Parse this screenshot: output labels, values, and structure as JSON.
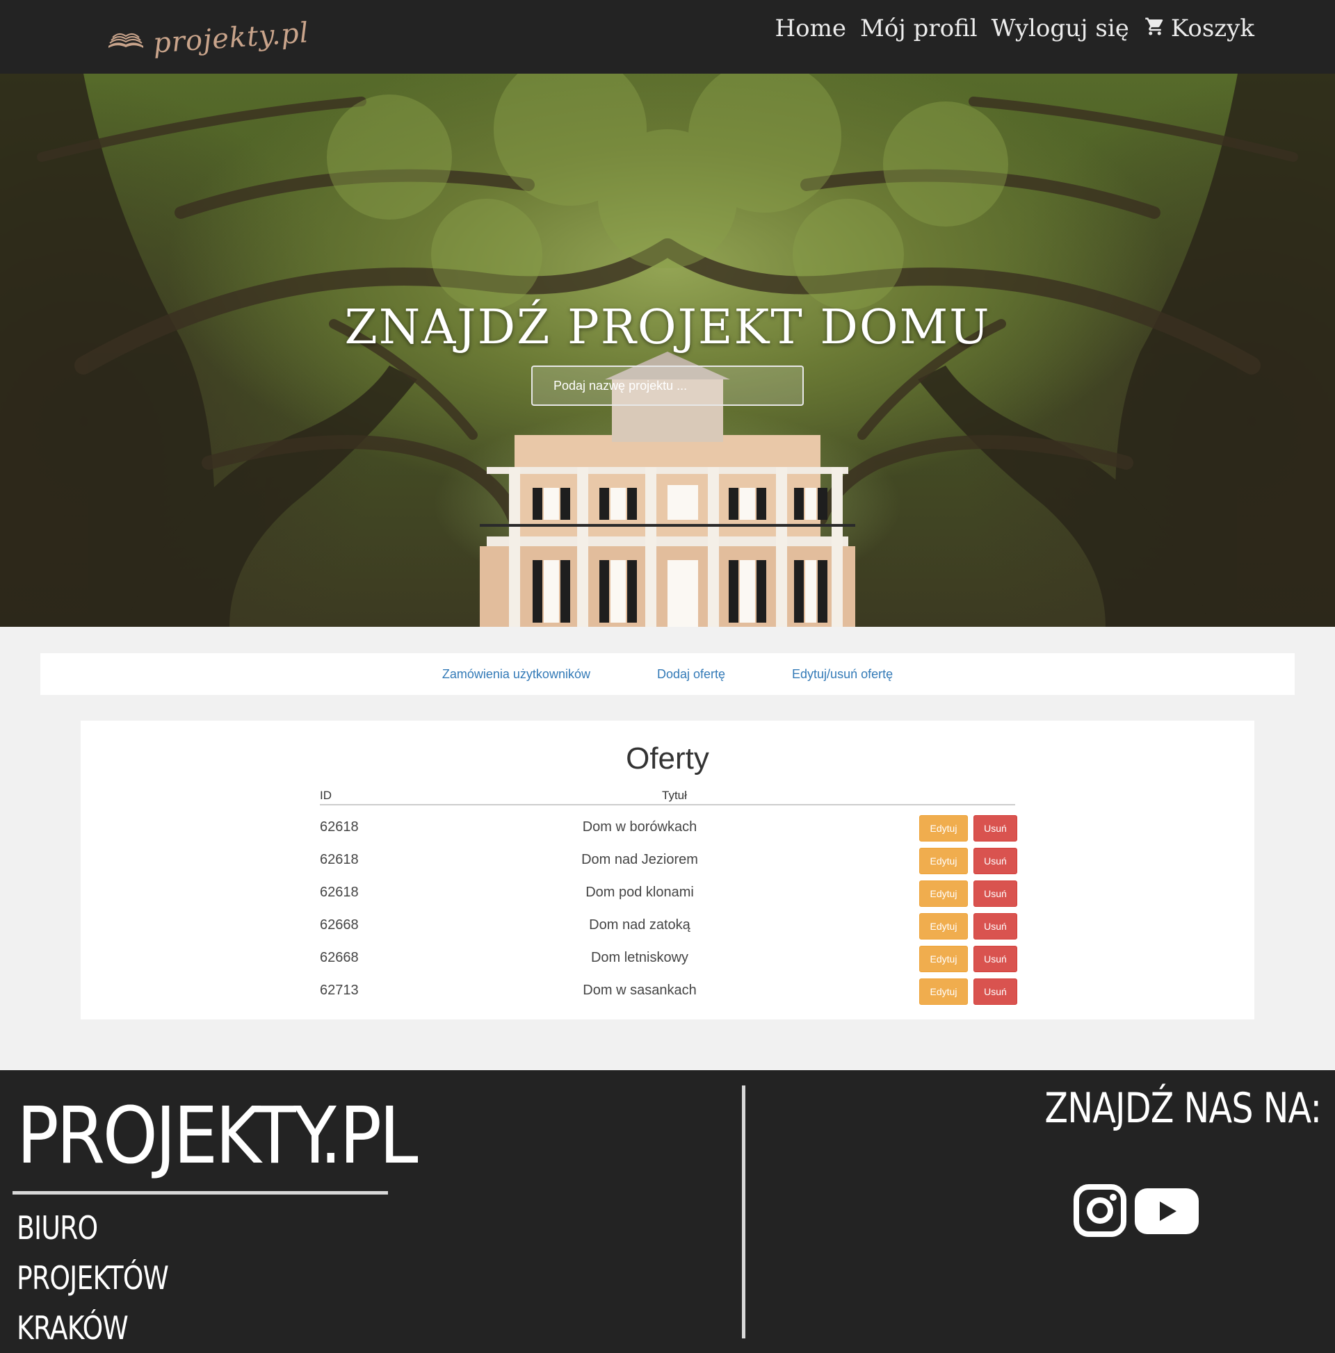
{
  "navbar": {
    "logo_text": "projekty.pl",
    "links": {
      "home": "Home",
      "profile": "Mój profil",
      "logout": "Wyloguj się",
      "cart": "Koszyk"
    }
  },
  "hero": {
    "title": "ZNAJDŹ PROJEKT DOMU",
    "search_placeholder": "Podaj nazwę projektu ..."
  },
  "admin_nav": {
    "orders": "Zamówienia użytkowników",
    "add_offer": "Dodaj ofertę",
    "edit_offer": "Edytuj/usuń ofertę"
  },
  "offers": {
    "title": "Oferty",
    "columns": {
      "id": "ID",
      "title": "Tytuł"
    },
    "edit_label": "Edytuj",
    "delete_label": "Usuń",
    "rows": [
      {
        "id": "62618",
        "title": "Dom w borówkach"
      },
      {
        "id": "62618",
        "title": "Dom nad Jeziorem"
      },
      {
        "id": "62618",
        "title": "Dom pod klonami"
      },
      {
        "id": "62668",
        "title": "Dom nad zatoką"
      },
      {
        "id": "62668",
        "title": "Dom letniskowy"
      },
      {
        "id": "62713",
        "title": "Dom w sasankach"
      }
    ]
  },
  "footer": {
    "brand": "PROJEKTY.PL",
    "lines": [
      "BIURO",
      "PROJEKTÓW",
      "KRAKÓW"
    ],
    "find_us": "ZNAJDŹ NAS NA:",
    "social_icons": [
      "instagram-icon",
      "youtube-icon"
    ]
  },
  "colors": {
    "navbar_bg": "#232323",
    "link_blue": "#337ab7",
    "edit_orange": "#f0ad4e",
    "delete_red": "#d9534f"
  }
}
